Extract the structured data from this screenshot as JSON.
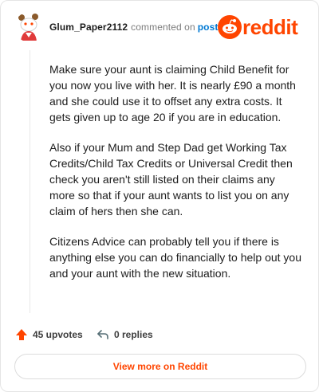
{
  "header": {
    "username": "Glum_Paper2112",
    "action_text": "commented on",
    "post_link": "post",
    "brand": "reddit"
  },
  "comment": {
    "paragraphs": [
      "Make sure your aunt is claiming Child Benefit for you now you live with her. It is nearly £90 a month and she could use it to offset any extra costs. It gets given up to age 20 if you are in education.",
      "Also if your Mum and Step Dad get Working Tax Credits/Child Tax Credits or Universal Credit then check you aren't still listed on their claims any more so that if your aunt wants to list you on any claim of hers then she can.",
      "Citizens Advice can probably tell you if there is anything else you can do financially to help out you and your aunt with the new situation."
    ]
  },
  "footer": {
    "upvotes_label": "45 upvotes",
    "replies_label": "0 replies",
    "view_more_label": "View more on Reddit"
  },
  "colors": {
    "brand": "#ff4500",
    "link": "#0079d3"
  },
  "icons": {
    "avatar": "snoo-avatar",
    "logo": "reddit-logo-icon",
    "upvote": "upvote-arrow-icon",
    "reply": "reply-arrow-icon"
  }
}
